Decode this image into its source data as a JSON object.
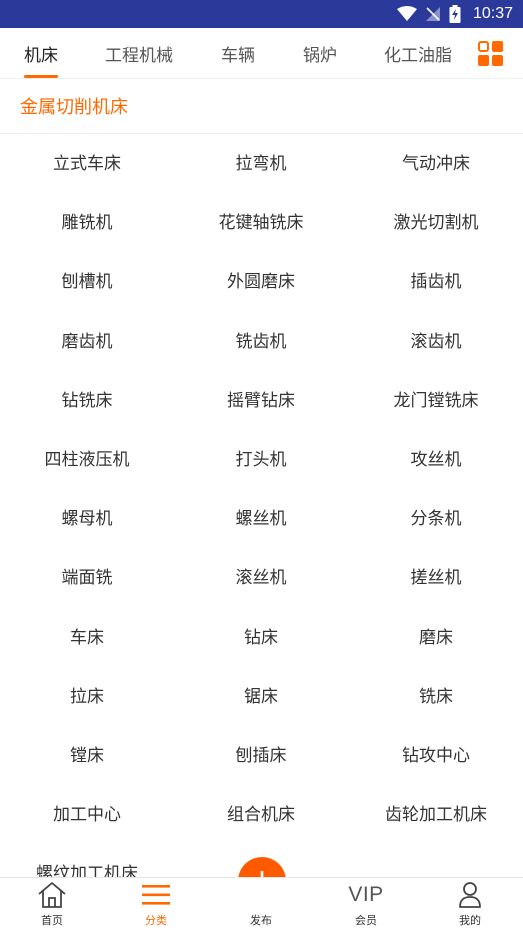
{
  "status_bar": {
    "time": "10:37"
  },
  "tabs": [
    {
      "label": "机床",
      "active": true
    },
    {
      "label": "工程机械",
      "active": false
    },
    {
      "label": "车辆",
      "active": false
    },
    {
      "label": "锅炉",
      "active": false
    },
    {
      "label": "化工油脂",
      "active": false
    }
  ],
  "section": {
    "title": "金属切削机床"
  },
  "items": [
    "立式车床",
    "拉弯机",
    "气动冲床",
    "雕铣机",
    "花键轴铣床",
    "激光切割机",
    "刨槽机",
    "外圆磨床",
    "插齿机",
    "磨齿机",
    "铣齿机",
    "滚齿机",
    "钻铣床",
    "摇臂钻床",
    "龙门镗铣床",
    "四柱液压机",
    "打头机",
    "攻丝机",
    "螺母机",
    "螺丝机",
    "分条机",
    "端面铣",
    "滚丝机",
    "搓丝机",
    "车床",
    "钻床",
    "磨床",
    "拉床",
    "锯床",
    "铣床",
    "镗床",
    "刨插床",
    "钻攻中心",
    "加工中心",
    "组合机床",
    "齿轮加工机床",
    "螺纹加工机床"
  ],
  "bottom_nav": {
    "home": "首页",
    "category": "分类",
    "publish": "发布",
    "vip_icon_text": "VIP",
    "member": "会员",
    "mine": "我的"
  },
  "colors": {
    "accent": "#ff6a00",
    "status_bar": "#2b3a9a",
    "fab": "#ff5a00"
  }
}
